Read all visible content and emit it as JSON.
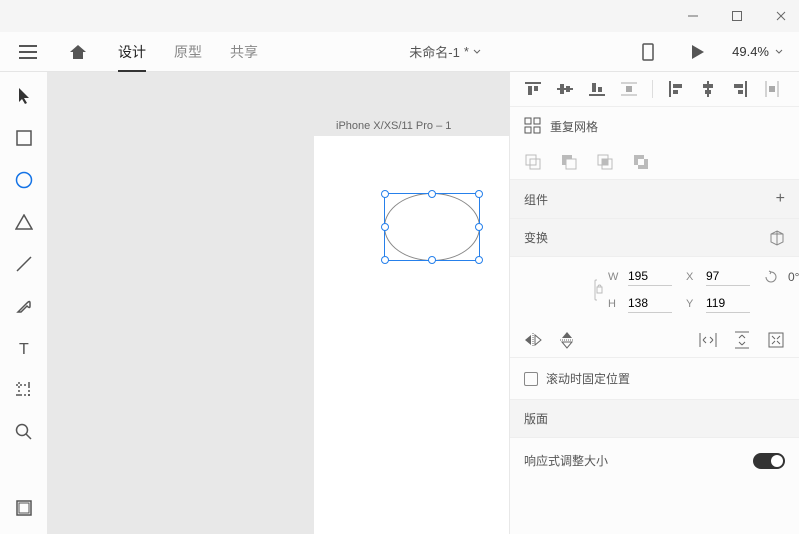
{
  "window": {
    "minimize": "minimize",
    "maximize": "maximize",
    "close": "close"
  },
  "topbar": {
    "tabs": {
      "design": "设计",
      "prototype": "原型",
      "share": "共享"
    },
    "docname": "未命名-1",
    "modified": "*",
    "zoom": "49.4%"
  },
  "canvas": {
    "artboard_name": "iPhone X/XS/11 Pro – 1"
  },
  "panel": {
    "repeat_grid": "重复网格",
    "component": "组件",
    "transform": "变换",
    "w_label": "W",
    "w_value": "195",
    "h_label": "H",
    "h_value": "138",
    "x_label": "X",
    "x_value": "97",
    "y_label": "Y",
    "y_value": "119",
    "rotation": "0°",
    "fix_scroll": "滚动时固定位置",
    "layout": "版面",
    "responsive": "响应式调整大小"
  }
}
